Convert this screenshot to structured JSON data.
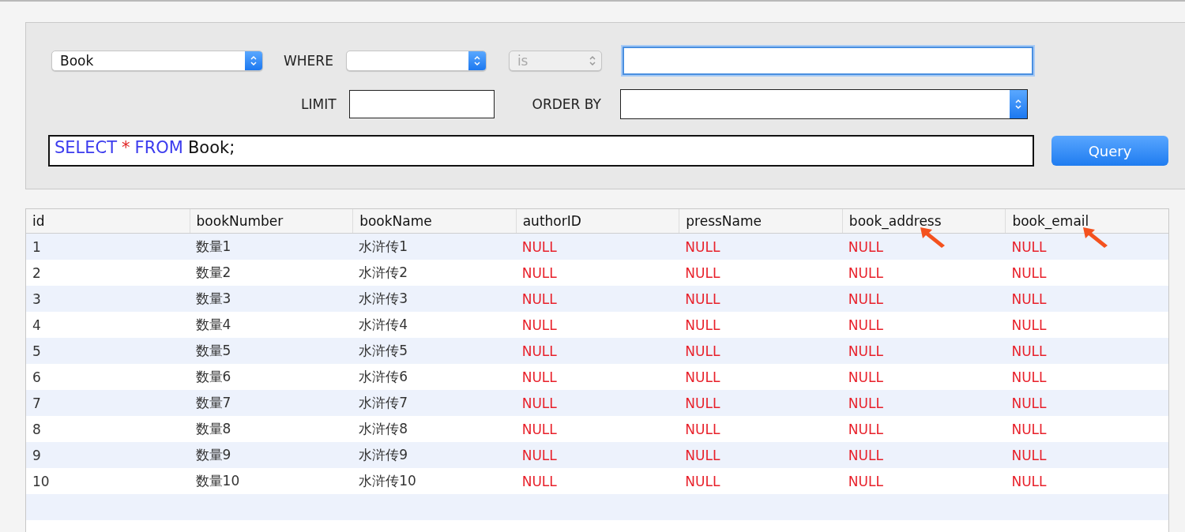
{
  "query_panel": {
    "table_select": {
      "value": "Book",
      "disabled": false
    },
    "where_label": "WHERE",
    "where_field": {
      "disabled": false
    },
    "operator": {
      "value": "is",
      "disabled": true
    },
    "value_input": {
      "focused": true
    },
    "limit_label": "LIMIT",
    "limit_input": {
      "focused": false
    },
    "order_by_label": "ORDER BY",
    "order_by_select": {
      "disabled": false
    },
    "sql": [
      {
        "kind": "keyword",
        "text": "SELECT"
      },
      {
        "kind": "operator",
        "text": "*"
      },
      {
        "kind": "keyword",
        "text": "FROM"
      },
      {
        "kind": "plain",
        "text": "Book;"
      }
    ],
    "query_button": "Query"
  },
  "table": {
    "columns": [
      {
        "label": "id",
        "arrow": false
      },
      {
        "label": "bookNumber",
        "arrow": false
      },
      {
        "label": "bookName",
        "arrow": false
      },
      {
        "label": "authorID",
        "arrow": false
      },
      {
        "label": "pressName",
        "arrow": false
      },
      {
        "label": "book_address",
        "arrow": true
      },
      {
        "label": "book_email",
        "arrow": true
      }
    ],
    "rows": [
      {
        "cells": [
          {
            "kind": "text",
            "text": "1"
          },
          {
            "kind": "text",
            "text": "数量1"
          },
          {
            "kind": "text",
            "text": "水浒传1"
          },
          {
            "kind": "null",
            "text": "NULL"
          },
          {
            "kind": "null",
            "text": "NULL"
          },
          {
            "kind": "null",
            "text": "NULL"
          },
          {
            "kind": "null",
            "text": "NULL"
          }
        ]
      },
      {
        "cells": [
          {
            "kind": "text",
            "text": "2"
          },
          {
            "kind": "text",
            "text": "数量2"
          },
          {
            "kind": "text",
            "text": "水浒传2"
          },
          {
            "kind": "null",
            "text": "NULL"
          },
          {
            "kind": "null",
            "text": "NULL"
          },
          {
            "kind": "null",
            "text": "NULL"
          },
          {
            "kind": "null",
            "text": "NULL"
          }
        ]
      },
      {
        "cells": [
          {
            "kind": "text",
            "text": "3"
          },
          {
            "kind": "text",
            "text": "数量3"
          },
          {
            "kind": "text",
            "text": "水浒传3"
          },
          {
            "kind": "null",
            "text": "NULL"
          },
          {
            "kind": "null",
            "text": "NULL"
          },
          {
            "kind": "null",
            "text": "NULL"
          },
          {
            "kind": "null",
            "text": "NULL"
          }
        ]
      },
      {
        "cells": [
          {
            "kind": "text",
            "text": "4"
          },
          {
            "kind": "text",
            "text": "数量4"
          },
          {
            "kind": "text",
            "text": "水浒传4"
          },
          {
            "kind": "null",
            "text": "NULL"
          },
          {
            "kind": "null",
            "text": "NULL"
          },
          {
            "kind": "null",
            "text": "NULL"
          },
          {
            "kind": "null",
            "text": "NULL"
          }
        ]
      },
      {
        "cells": [
          {
            "kind": "text",
            "text": "5"
          },
          {
            "kind": "text",
            "text": "数量5"
          },
          {
            "kind": "text",
            "text": "水浒传5"
          },
          {
            "kind": "null",
            "text": "NULL"
          },
          {
            "kind": "null",
            "text": "NULL"
          },
          {
            "kind": "null",
            "text": "NULL"
          },
          {
            "kind": "null",
            "text": "NULL"
          }
        ]
      },
      {
        "cells": [
          {
            "kind": "text",
            "text": "6"
          },
          {
            "kind": "text",
            "text": "数量6"
          },
          {
            "kind": "text",
            "text": "水浒传6"
          },
          {
            "kind": "null",
            "text": "NULL"
          },
          {
            "kind": "null",
            "text": "NULL"
          },
          {
            "kind": "null",
            "text": "NULL"
          },
          {
            "kind": "null",
            "text": "NULL"
          }
        ]
      },
      {
        "cells": [
          {
            "kind": "text",
            "text": "7"
          },
          {
            "kind": "text",
            "text": "数量7"
          },
          {
            "kind": "text",
            "text": "水浒传7"
          },
          {
            "kind": "null",
            "text": "NULL"
          },
          {
            "kind": "null",
            "text": "NULL"
          },
          {
            "kind": "null",
            "text": "NULL"
          },
          {
            "kind": "null",
            "text": "NULL"
          }
        ]
      },
      {
        "cells": [
          {
            "kind": "text",
            "text": "8"
          },
          {
            "kind": "text",
            "text": "数量8"
          },
          {
            "kind": "text",
            "text": "水浒传8"
          },
          {
            "kind": "null",
            "text": "NULL"
          },
          {
            "kind": "null",
            "text": "NULL"
          },
          {
            "kind": "null",
            "text": "NULL"
          },
          {
            "kind": "null",
            "text": "NULL"
          }
        ]
      },
      {
        "cells": [
          {
            "kind": "text",
            "text": "9"
          },
          {
            "kind": "text",
            "text": "数量9"
          },
          {
            "kind": "text",
            "text": "水浒传9"
          },
          {
            "kind": "null",
            "text": "NULL"
          },
          {
            "kind": "null",
            "text": "NULL"
          },
          {
            "kind": "null",
            "text": "NULL"
          },
          {
            "kind": "null",
            "text": "NULL"
          }
        ]
      },
      {
        "cells": [
          {
            "kind": "text",
            "text": "10"
          },
          {
            "kind": "text",
            "text": "数量10"
          },
          {
            "kind": "text",
            "text": "水浒传10"
          },
          {
            "kind": "null",
            "text": "NULL"
          },
          {
            "kind": "null",
            "text": "NULL"
          },
          {
            "kind": "null",
            "text": "NULL"
          },
          {
            "kind": "null",
            "text": "NULL"
          }
        ]
      }
    ]
  }
}
